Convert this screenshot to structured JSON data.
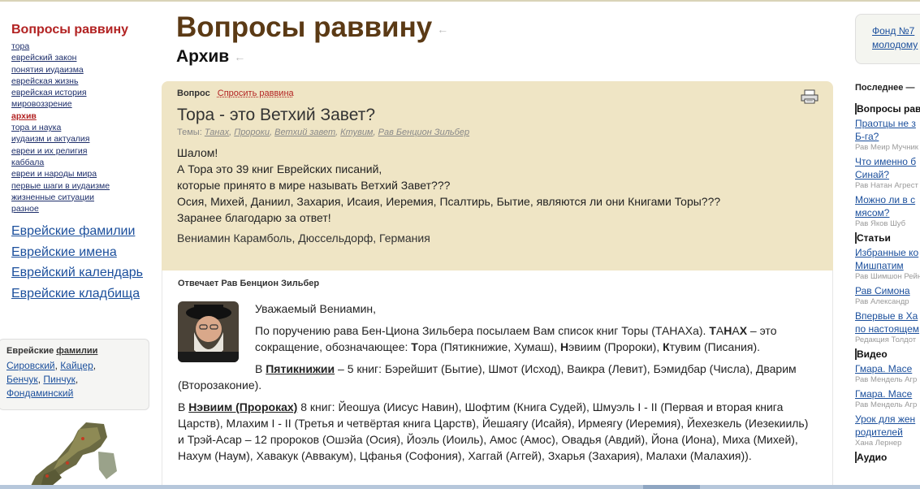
{
  "left": {
    "site_title": "Вопросы раввину",
    "nav": [
      "тора",
      "еврейский закон",
      "понятия иудаизма",
      "еврейская жизнь",
      "еврейская история",
      "мировоззрение",
      "архив",
      "тора и наука",
      "иудаизм и актуалия",
      "евреи и их религия",
      "каббала",
      "евреи и народы мира",
      "первые шаги в иудаизме",
      "жизненные ситуации",
      "разное"
    ],
    "active_nav": "архив",
    "big_links": [
      "Еврейские фамилии",
      "Еврейские имена",
      "Еврейский календарь",
      "Еврейские кладбища"
    ],
    "surnames_box": {
      "title_prefix": "Еврейские",
      "title_link": "фамилии",
      "names": [
        "Сировский",
        "Кайцер",
        "Бенчук",
        "Пинчук",
        "Фондаминский"
      ]
    }
  },
  "main": {
    "title": "Вопросы раввину",
    "subtitle": "Архив",
    "arrow_glyph": "←",
    "question": {
      "label": "Вопрос",
      "ask_link": "Спросить раввина",
      "title": "Тора - это Ветхий Завет?",
      "topics_label": "Темы:",
      "topics": [
        "Танах",
        "Пророки",
        "Ветхий завет",
        "Ктувим",
        "Рав Бенцион Зильбер"
      ],
      "body_lines": [
        "Шалом!",
        "А Тора это 39 книг Еврейских писаний,",
        "которые принято в мире называть Ветхий Завет???",
        "Осия, Михей, Даниил, Захария, Исаия, Иеремия, Псалтирь, Бытие, являются ли они Книгами Торы???",
        "Заранее благодарю за ответ!"
      ],
      "signature": "Вениамин Карамболь, Дюссельдорф, Германия"
    },
    "answer": {
      "answered_by": "Отвечает Рав Бенцион Зильбер",
      "greeting": "Уважаемый Вениамин,",
      "p1": {
        "a": "По поручению рава Бен-Циона Зильбера посылаем Вам список книг Торы (ТАНАХа). ",
        "b1": "Т",
        "b2": "А",
        "b3": "Н",
        "b4": "А",
        "b5": "Х",
        "c": " – это сокращение, обозначающее: ",
        "t_bold": "Т",
        "t_rest": "ора (Пятикнижие, Хумаш), ",
        "n_bold": "Н",
        "n_rest": "эвиим (Пророки), ",
        "k_bold": "К",
        "k_rest": "тувим (Писания)."
      },
      "p2": {
        "pre": "В ",
        "bold": "Пятикнижии",
        "rest": " – 5 книг: Бэрейшит (Бытие), Шмот (Исход), Ваикра (Левит), Бэмидбар (Числа), Дварим (Второзаконие)."
      },
      "p3": {
        "pre": "В ",
        "bold": "Нэвиим (Пророках)",
        "rest": " 8 книг: Йеошуа (Иисус Навин), Шофтим (Книга Судей), Шмуэль I - II (Первая и вторая книга Царств), Млахим I - II (Третья и четвёртая книга Царств), Йешаягу (Исайя), Ирмеягу (Иеремия), Йехезкель (Иезекииль) и Трэй-Асар – 12 пророков (Ошэйа (Осия), Йоэль (Иоиль), Амос (Амос), Овадья (Авдий), Йона (Иона), Миха (Михей), Нахум (Наум), Хавакук (Аввакум), Цфанья (Софония), Хаггай (Аггей), Зхарья (Захария), Малахи (Малахия))."
      }
    }
  },
  "right": {
    "fund": [
      "Фонд №7",
      "молодому"
    ],
    "latest": "Последнее —",
    "sections": [
      {
        "title": "Вопросы раввину",
        "items": [
          {
            "lines": [
              "Праотцы не з",
              "Б-га?"
            ],
            "author": "Рав Меир Мучник"
          },
          {
            "lines": [
              "Что именно б",
              "Синай?"
            ],
            "author": "Рав Натан Агрест"
          },
          {
            "lines": [
              "Можно ли в с",
              "мясом?"
            ],
            "author": "Рав Яков Шуб"
          }
        ]
      },
      {
        "title": "Статьи",
        "items": [
          {
            "lines": [
              "Избранные ко",
              "Мишпатим"
            ],
            "author": "Рав Шимшон Рейн"
          },
          {
            "lines": [
              "Рав Симона"
            ],
            "author": "Рав Александр"
          },
          {
            "lines": [
              "Впервые в Ха",
              "по настоящем"
            ],
            "author": "Редакция Толдот"
          }
        ]
      },
      {
        "title": "Видео",
        "items": [
          {
            "lines": [
              "Гмара. Масе"
            ],
            "author": "Рав Мендель Агр"
          },
          {
            "lines": [
              "Гмара. Масе"
            ],
            "author": "Рав Мендель Агр"
          },
          {
            "lines": [
              "Урок для жен",
              "родителей"
            ],
            "author": "Хана Лернер"
          }
        ]
      },
      {
        "title": "Аудио",
        "items": []
      }
    ]
  },
  "colors": {
    "brand_brown": "#5b3a15",
    "accent_red": "#b22222",
    "link_blue": "#1b4f9c",
    "question_bg": "#efe5c5"
  }
}
